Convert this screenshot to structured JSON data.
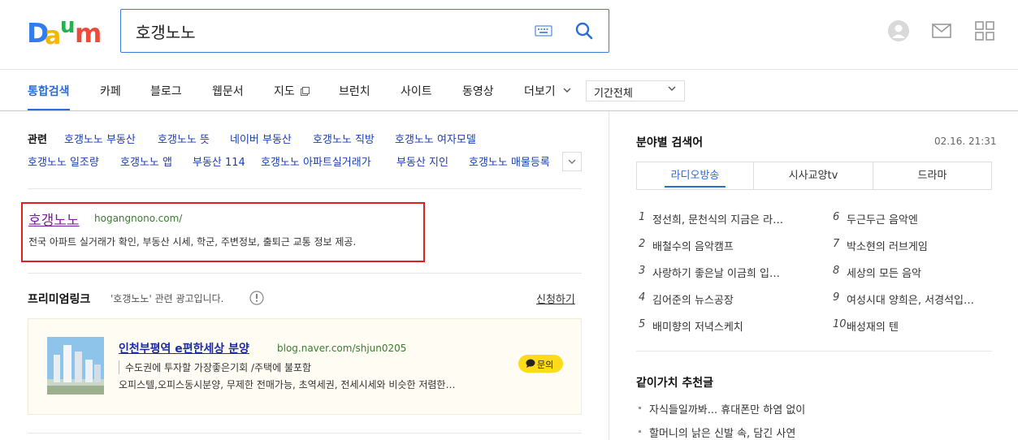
{
  "search": {
    "query": "호갱노노"
  },
  "tabs": [
    {
      "label": "통합검색"
    },
    {
      "label": "카페"
    },
    {
      "label": "블로그"
    },
    {
      "label": "웹문서"
    },
    {
      "label": "지도"
    },
    {
      "label": "브런치"
    },
    {
      "label": "사이트"
    },
    {
      "label": "동영상"
    },
    {
      "label": "더보기"
    }
  ],
  "period": {
    "selected": "기간전체"
  },
  "related": {
    "heading": "관련",
    "row1": [
      "호갱노노 부동산",
      "호갱노노 뜻",
      "네이버 부동산",
      "호갱노노 직방",
      "호갱노노 여자모델"
    ],
    "row2": [
      "호갱노노 일조량",
      "호갱노노 앱",
      "부동산 114",
      "호갱노노 아파트실거래가",
      "부동산 지인",
      "호갱노노 매물등록"
    ]
  },
  "result": {
    "title": "호갱노노",
    "url": "hogangnono.com/",
    "description": "전국 아파트 실거래가 확인, 부동산 시세, 학군, 주변정보, 출퇴근 교통 정보 제공."
  },
  "premium": {
    "title": "프리미엄링크",
    "note": "'호갱노노' 관련 광고입니다.",
    "apply": "신청하기",
    "ad": {
      "title": "인천부평역 e편한세상 분양",
      "url": "blog.naver.com/shjun0205",
      "subtitle": "수도권에 투자할 가장좋은기회 /주택에 불포함",
      "description": "오피스텔,오피스동시분양, 무제한 전매가능, 초역세권, 전세시세와 비슷한 저렴한…",
      "button": "문의"
    }
  },
  "sidebar": {
    "title": "분야별 검색어",
    "time": "02.16. 21:31",
    "tabs": [
      "라디오방송",
      "시사교양tv",
      "드라마"
    ],
    "left_ranks": [
      {
        "num": "1",
        "text": "정선희, 문천식의 지금은 라…"
      },
      {
        "num": "2",
        "text": "배철수의 음악캠프"
      },
      {
        "num": "3",
        "text": "사랑하기 좋은날 이금희 입…"
      },
      {
        "num": "4",
        "text": "김어준의 뉴스공장"
      },
      {
        "num": "5",
        "text": "배미향의 저녁스케치"
      }
    ],
    "right_ranks": [
      {
        "num": "6",
        "text": "두근두근 음악엔"
      },
      {
        "num": "7",
        "text": "박소현의 러브게임"
      },
      {
        "num": "8",
        "text": "세상의 모든 음악"
      },
      {
        "num": "9",
        "text": "여성시대 양희은, 서경석입…"
      },
      {
        "num": "10",
        "text": "배성재의 텐"
      }
    ],
    "recommend_title": "같이가치 추천글",
    "recommend": [
      "자식들일까봐... 휴대폰만 하염 없이",
      "할머니의 낡은 신발 속, 담긴 사연"
    ]
  },
  "colors": {
    "accent": "#2a6cd8",
    "highlight_border": "#e02020",
    "visited_link": "#7a1fa2"
  }
}
